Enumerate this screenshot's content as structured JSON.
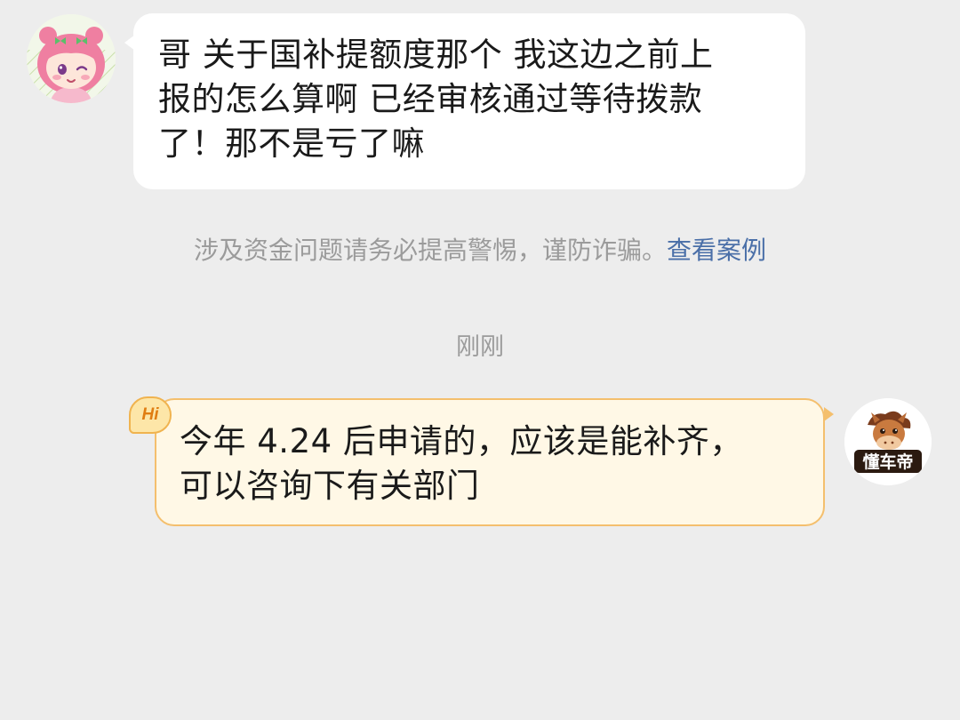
{
  "incoming_message": {
    "text": "哥 关于国补提额度那个 我这边之前上\n报的怎么算啊 已经审核通过等待拨款\n了！那不是亏了嘛",
    "avatar_icon": "cartoon-girl-avatar-icon"
  },
  "system_notice": {
    "text": "涉及资金问题请务必提高警惕，谨防诈骗。",
    "link_label": "查看案例",
    "link_color": "#4a6fa8"
  },
  "timestamp": "刚刚",
  "outgoing_message": {
    "badge": "Hi",
    "text": "今年 4.24 后申请的，应该是能补齐，\n可以咨询下有关部门",
    "avatar_icon": "dongchedi-horse-logo-icon",
    "avatar_logo_text": "懂车帝",
    "bubble_color": "#fff8e6",
    "border_color": "#f4bf6d"
  }
}
